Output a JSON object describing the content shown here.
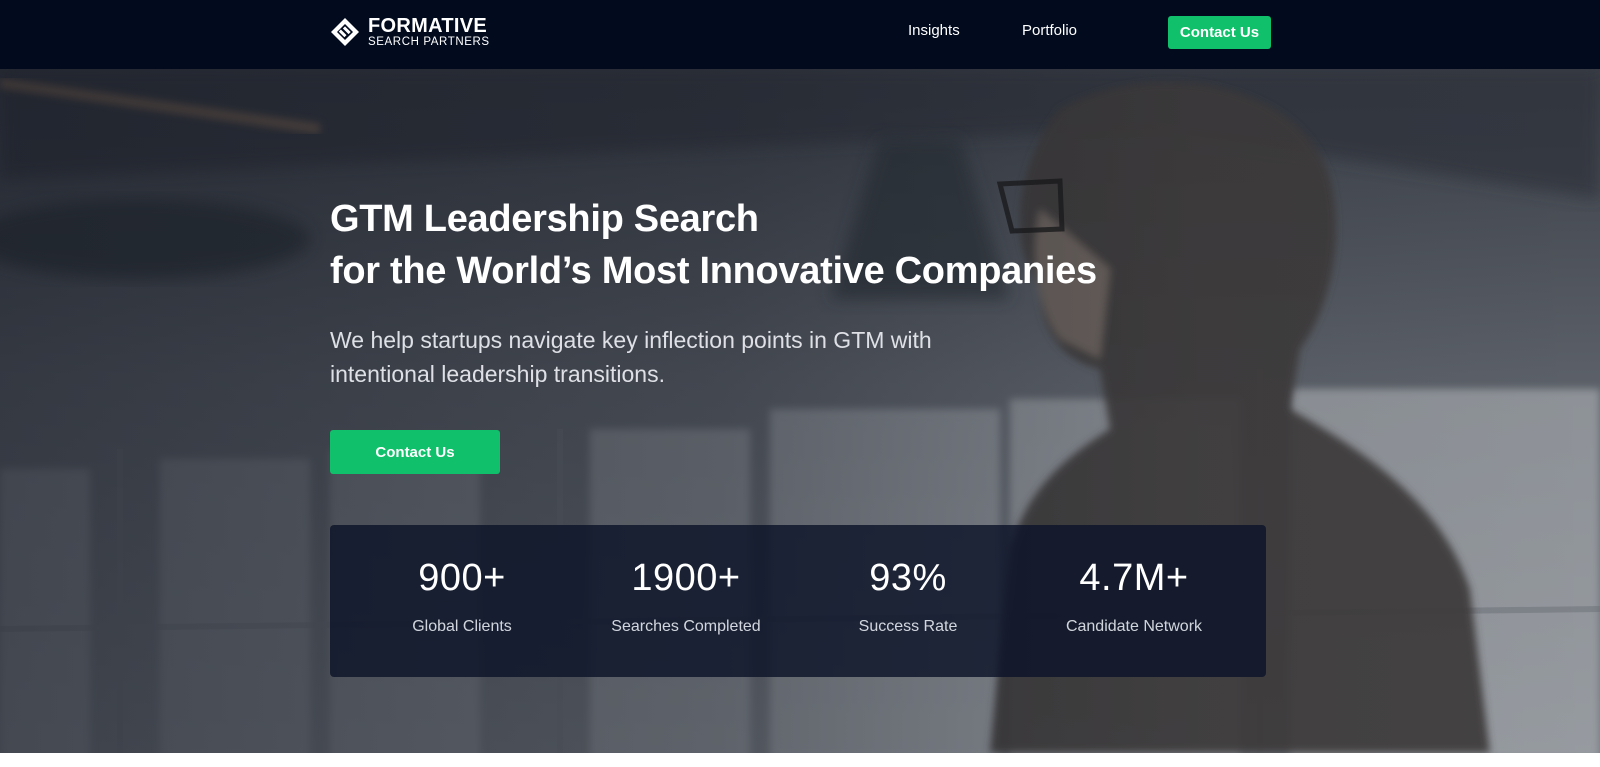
{
  "nav": {
    "brand_name": "FORMATIVE",
    "brand_tagline": "SEARCH PARTNERS",
    "links": [
      "Insights",
      "Portfolio"
    ],
    "cta_label": "Contact Us"
  },
  "hero": {
    "title_line1": "GTM Leadership Search",
    "title_line2": "for the World’s Most Innovative Companies",
    "subtitle": "We help startups navigate key inflection points in GTM with intentional leadership transitions.",
    "cta_label": "Contact Us"
  },
  "stats": [
    {
      "value": "900+",
      "label": "Global Clients"
    },
    {
      "value": "1900+",
      "label": "Searches Completed"
    },
    {
      "value": "93%",
      "label": "Success Rate"
    },
    {
      "value": "4.7M+",
      "label": "Candidate Network"
    }
  ],
  "icons": {
    "logo": "formative-logo-icon"
  },
  "colors": {
    "nav_background": "#020b1e",
    "accent_green": "#10c06a",
    "stats_panel": "#0c1328"
  }
}
